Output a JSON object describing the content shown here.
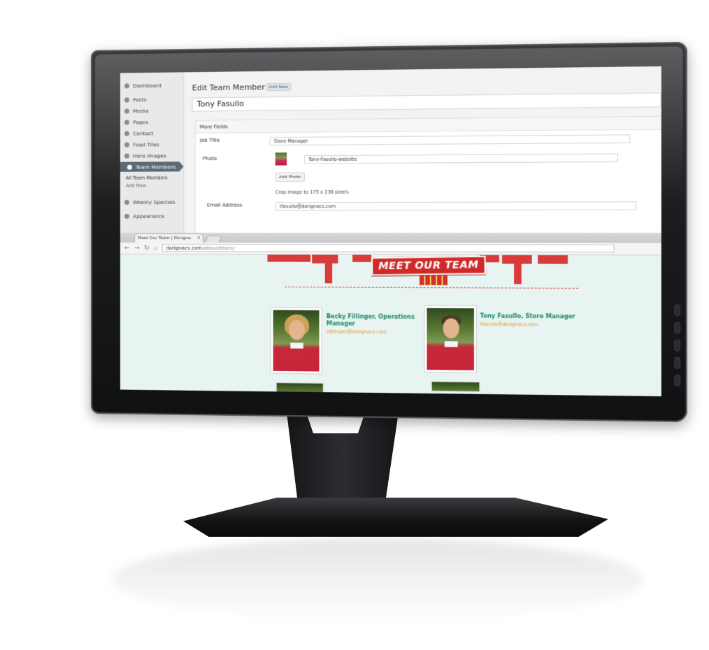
{
  "admin": {
    "sidebar": {
      "items": [
        {
          "label": "Dashboard"
        },
        {
          "label": "Posts"
        },
        {
          "label": "Media"
        },
        {
          "label": "Pages"
        },
        {
          "label": "Contact"
        },
        {
          "label": "Food Tiles"
        },
        {
          "label": "Hero Images"
        },
        {
          "label": "Team Members"
        },
        {
          "label": "Weekly Specials"
        },
        {
          "label": "Appearance"
        }
      ],
      "submenu": [
        "All Team Members",
        "Add New"
      ]
    },
    "heading": "Edit Team Member",
    "add_new": "Add New",
    "title_value": "Tony Fasullo",
    "box_title": "More Fields",
    "fields": {
      "job_title_label": "Job Title",
      "job_title_value": "Store Manager",
      "photo_label": "Photo",
      "photo_value": "Tony-Fasullo-website",
      "add_photo": "Add Photo",
      "crop_note": "Crop image to 175 x 238 pixels",
      "email_label": "Email Address",
      "email_value": "tfasullo@dorignacs.com"
    }
  },
  "browser": {
    "tab_title": "Meet Our Team | Dorigna",
    "url_host": "dorignacs.com",
    "url_path": "/about/team/"
  },
  "site": {
    "banner": "MEET OUR TEAM",
    "members": [
      {
        "name": "Becky Fillinger, Operations Manager",
        "email": "bfillinger@dorignacs.com"
      },
      {
        "name": "Tony Fasullo, Store Manager",
        "email": "tfasullo@dorignacs.com"
      }
    ]
  },
  "colors": {
    "accent_red": "#cf2a2a",
    "name_green": "#1f8a6b",
    "email_orange": "#e8962b",
    "site_bg": "#e8f4f1"
  }
}
